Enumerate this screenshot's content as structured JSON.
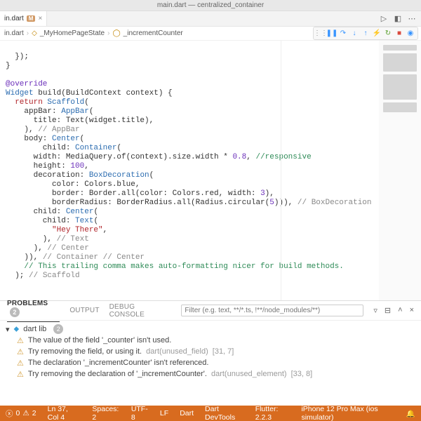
{
  "window": {
    "title": "main.dart — centralized_container"
  },
  "tab": {
    "name": "in.dart",
    "modified": "M"
  },
  "breadcrumb": {
    "a": "_MyHomePageState",
    "b": "_incrementCounter"
  },
  "code": {
    "l1": "  });",
    "l2": "}",
    "anno": "@override",
    "buildSig1": "Widget ",
    "buildSig2": "build",
    "buildSig3": "(BuildContext context) {",
    "ret": "  return ",
    "scaffold": "Scaffold",
    "retEnd": "(",
    "appbarK": "    appBar: ",
    "appbarV": "AppBar",
    "appbarEnd": "(",
    "titleLine": "      title: Text(widget.title),",
    "appbarClose": "    ), ",
    "appbarCm": "// AppBar",
    "bodyK": "    body: ",
    "center": "Center",
    "bodyEnd": "(",
    "childK": "        child: ",
    "container": "Container",
    "childEnd": "(",
    "widthLine1": "      width: MediaQuery.of(context).size.width * ",
    "widthNum": "0.8",
    "widthComma": ", ",
    "widthCm": "//responsive",
    "heightLine": "      height: ",
    "heightNum": "100",
    "heightComma": ",",
    "decoK": "      decoration: ",
    "boxdeco": "BoxDecoration",
    "decoEnd": "(",
    "colorLine": "          color: Colors.blue,",
    "borderLine1": "          border: Border.all(color: Colors.red, width: ",
    "borderNum": "3",
    "borderEnd": "),",
    "brLine1": "          borderRadius: BorderRadius.all(Radius.circular(",
    "brNum": "5",
    "brEnd": "))), ",
    "brCm": "// BoxDecoration",
    "child2K": "      child: ",
    "center2": "Center",
    "child2End": "(",
    "child3K": "        child: ",
    "text": "Text",
    "child3End": "(",
    "heyStr": "\"Hey There\"",
    "heyComma": ",",
    "textClose": "        ), ",
    "textCm": "// Text",
    "centerClose": "      ), ",
    "centerCm": "// Center",
    "containerClose": "    )), ",
    "containerCm": "// Container // Center",
    "trailing": "    // This trailing comma makes auto-formatting nicer for build methods.",
    "scaffoldClose": "  ); ",
    "scaffoldCm": "// Scaffold"
  },
  "panel": {
    "tabs": {
      "problems": "PROBLEMS",
      "problemsCount": "2",
      "output": "OUTPUT",
      "debug": "DEBUG CONSOLE"
    },
    "filterPlaceholder": "Filter (e.g. text, **/*.ts, !**/node_modules/**)",
    "group": "dart lib",
    "groupCount": "2",
    "p1": "The value of the field '_counter' isn't used.",
    "p1hint": "Try removing the field, or using it. ",
    "p1code": "dart(unused_field)",
    "p1loc": "  [31, 7]",
    "p2": "The declaration '_incrementCounter' isn't referenced.",
    "p2hint": "Try removing the declaration of '_incrementCounter'. ",
    "p2code": "dart(unused_element)",
    "p2loc": "  [33, 8]"
  },
  "status": {
    "errors": "0",
    "warnings": "2",
    "pos": "Ln 37, Col 4",
    "spaces": "Spaces: 2",
    "enc": "UTF-8",
    "eol": "LF",
    "lang": "Dart",
    "devtools": "Dart DevTools",
    "flutter": "Flutter: 2.2.3",
    "device": "iPhone 12 Pro Max (ios simulator)"
  }
}
